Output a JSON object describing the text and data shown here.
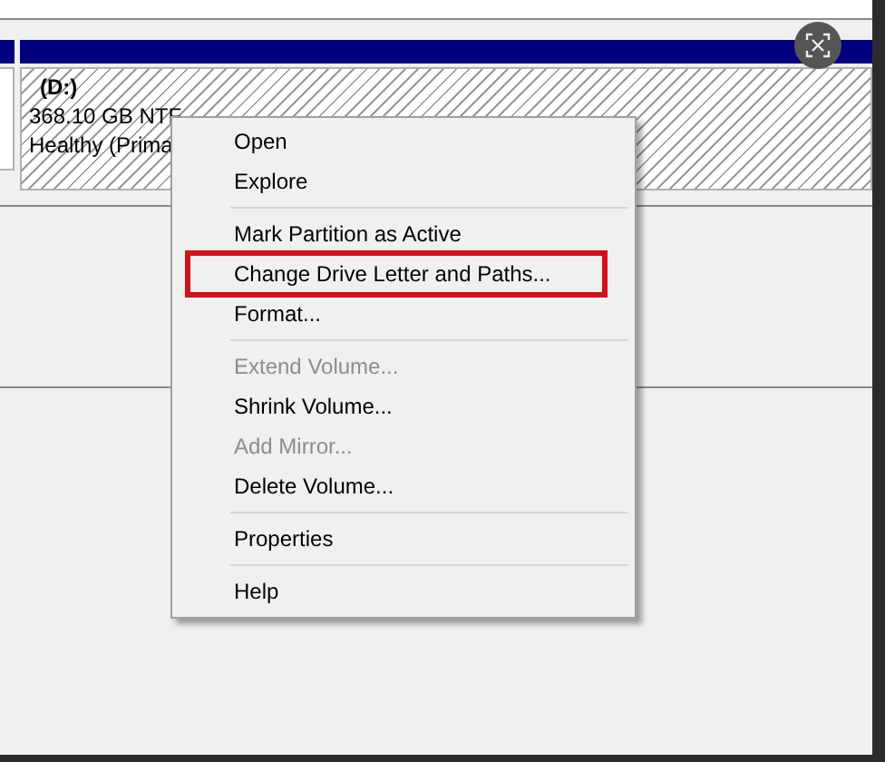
{
  "partition": {
    "drive": "(D:)",
    "size": "368.10 GB NTF",
    "status": "Healthy (Prima"
  },
  "context_menu": {
    "groups": [
      [
        {
          "label": "Open",
          "disabled": false,
          "highlighted": false
        },
        {
          "label": "Explore",
          "disabled": false,
          "highlighted": false
        }
      ],
      [
        {
          "label": "Mark Partition as Active",
          "disabled": false,
          "highlighted": false
        },
        {
          "label": "Change Drive Letter and Paths...",
          "disabled": false,
          "highlighted": true
        },
        {
          "label": "Format...",
          "disabled": false,
          "highlighted": false
        }
      ],
      [
        {
          "label": "Extend Volume...",
          "disabled": true,
          "highlighted": false
        },
        {
          "label": "Shrink Volume...",
          "disabled": false,
          "highlighted": false
        },
        {
          "label": "Add Mirror...",
          "disabled": true,
          "highlighted": false
        },
        {
          "label": "Delete Volume...",
          "disabled": false,
          "highlighted": false
        }
      ],
      [
        {
          "label": "Properties",
          "disabled": false,
          "highlighted": false
        }
      ],
      [
        {
          "label": "Help",
          "disabled": false,
          "highlighted": false
        }
      ]
    ]
  }
}
